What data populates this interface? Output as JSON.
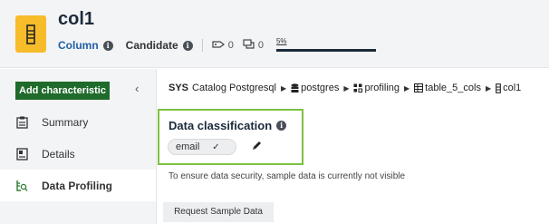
{
  "header": {
    "title": "col1",
    "type_label": "Column",
    "status_label": "Candidate",
    "tag_count": "0",
    "comment_count": "0",
    "progress_label": "5%",
    "progress_value": 0.05
  },
  "sidebar": {
    "add_button": "Add characteristic",
    "items": [
      {
        "label": "Summary",
        "icon": "summary-icon"
      },
      {
        "label": "Details",
        "icon": "details-icon"
      },
      {
        "label": "Data Profiling",
        "icon": "data-profiling-icon"
      }
    ],
    "active_item": "Data Profiling"
  },
  "breadcrumb": {
    "sys": "SYS",
    "items": [
      "Catalog Postgresql",
      "postgres",
      "profiling",
      "table_5_cols",
      "col1"
    ]
  },
  "classification": {
    "title": "Data classification",
    "chip_label": "email"
  },
  "notice": "To ensure data security, sample data is currently not visible",
  "sample_button": "Request Sample Data",
  "colors": {
    "accent_green": "#1f6b2b",
    "highlight_green": "#7cc142",
    "logo_yellow": "#f7bc2a",
    "link_blue": "#1f5fa6"
  }
}
